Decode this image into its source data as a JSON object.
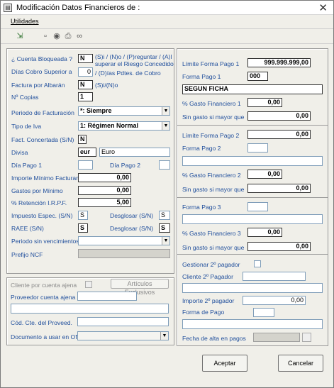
{
  "window": {
    "title": "Modificación Datos Financieros de :"
  },
  "menu": {
    "utilidades": "Utilidades"
  },
  "left": {
    "cuenta_bloqueada": {
      "label": "¿ Cuenta Bloqueada ?",
      "value": "N",
      "help": "(S)i / (N)o / (P)reguntar / (A)l superar el Riesgo Concedido"
    },
    "dias_cobro": {
      "label": "Días Cobro Superior a",
      "value": "0",
      "help": "/ (D)ías  Pdtes. de Cobro"
    },
    "factura_albaran": {
      "label": "Factura por Albarán",
      "value": "N",
      "help": "(S)i/(N)o"
    },
    "copias": {
      "label": "Nº Copias",
      "value": "1"
    },
    "periodo_facturacion": {
      "label": "Periodo de Facturación",
      "value": "*: Siempre"
    },
    "tipo_iva": {
      "label": "Tipo de Iva",
      "value": "1: Régimen Normal"
    },
    "fact_concertada": {
      "label": "Fact. Concertada (S/N)",
      "value": "N"
    },
    "divisa": {
      "label": "Divisa",
      "code": "eur",
      "name": "Euro"
    },
    "dia_pago1": {
      "label": "Día Pago 1",
      "value": ""
    },
    "dia_pago2": {
      "label": "Día Pago 2",
      "value": ""
    },
    "importe_minimo": {
      "label": "Importe Mínimo Facturar",
      "value": "0,00"
    },
    "gastos_minimo": {
      "label": "Gastos por Mínimo",
      "value": "0,00"
    },
    "retencion": {
      "label": "% Retención I.R.P.F.",
      "value": "5,00"
    },
    "impuesto_espec": {
      "label": "Impuesto Espec. (S/N)",
      "value": "S"
    },
    "desglosar1": {
      "label": "Desglosar (S/N)",
      "value": "S"
    },
    "raee": {
      "label": "RAEE (S/N)",
      "value": "S"
    },
    "desglosar2": {
      "label": "Desglosar (S/N)",
      "value": "S"
    },
    "periodo_sin_venc": {
      "label": "Periodo sin vencimientos",
      "value": ""
    },
    "prefijo_ncf": {
      "label": "Prefijo NCF",
      "value": ""
    }
  },
  "left_bottom": {
    "cliente_cuenta_ajena": "Cliente por cuenta ajena",
    "articulos_exclusivos": "Artículos Exclusivos",
    "proveedor_cuenta_ajena": "Proveedor cuenta ajena",
    "cod_cte_proveed": "Cód. Cte. del Proveed.",
    "documento_ofventa": "Documento a usar en OfVenta"
  },
  "right": {
    "limite_forma_pago1": {
      "label": "Límite Forma Pago 1",
      "value": "999.999.999,00"
    },
    "forma_pago1": {
      "label": "Forma Pago 1",
      "value": "000",
      "desc": "SEGUN FICHA"
    },
    "gasto_fin1": {
      "label": "% Gasto Financiero 1",
      "value": "0,00"
    },
    "sin_gasto1": {
      "label": "Sin gasto si mayor que",
      "value": "0,00"
    },
    "limite_forma_pago2": {
      "label": "Límite Forma Pago 2",
      "value": "0,00"
    },
    "forma_pago2": {
      "label": "Forma Pago 2",
      "value": "",
      "desc": ""
    },
    "gasto_fin2": {
      "label": "% Gasto Financiero 2",
      "value": "0,00"
    },
    "sin_gasto2": {
      "label": "Sin gasto si mayor que",
      "value": "0,00"
    },
    "forma_pago3": {
      "label": "Forma Pago 3",
      "value": "",
      "desc": ""
    },
    "gasto_fin3": {
      "label": "% Gasto Financiero 3",
      "value": "0,00"
    },
    "sin_gasto3": {
      "label": "Sin gasto si mayor que",
      "value": "0,00"
    },
    "gestionar_2pagador": {
      "label": "Gestionar 2º pagador"
    },
    "cliente_2pagador": {
      "label": "Cliente 2º Pagador",
      "value": ""
    },
    "importe_2pagador": {
      "label": "Importe 2º pagador",
      "value": "0,00"
    },
    "forma_de_pago": {
      "label": "Forma de Pago",
      "value": ""
    },
    "fecha_alta_pagos": {
      "label": "Fecha de alta en pagos",
      "value": ""
    }
  },
  "buttons": {
    "aceptar": "Aceptar",
    "cancelar": "Cancelar"
  }
}
